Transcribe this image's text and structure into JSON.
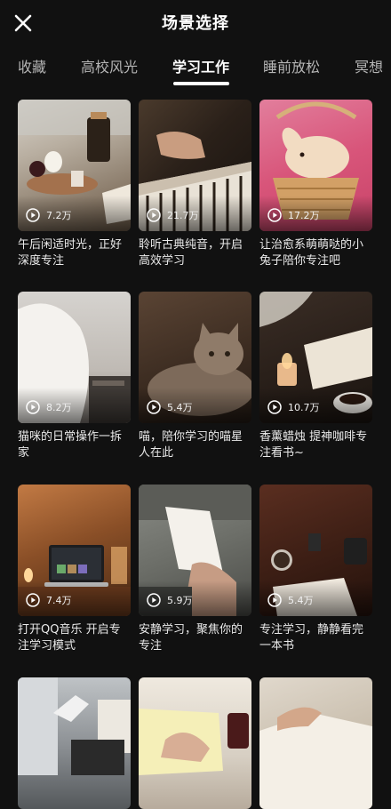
{
  "header": {
    "title": "场景选择"
  },
  "tabs": [
    {
      "label": "收藏"
    },
    {
      "label": "高校风光"
    },
    {
      "label": "学习工作"
    },
    {
      "label": "睡前放松"
    },
    {
      "label": "冥想"
    }
  ],
  "active_tab": 2,
  "cards": [
    {
      "plays": "7.2万",
      "caption": "午后闲适时光，正好深度专注"
    },
    {
      "plays": "21.7万",
      "caption": "聆听古典纯音，开启高效学习"
    },
    {
      "plays": "17.2万",
      "caption": "让治愈系萌萌哒的小兔子陪你专注吧"
    },
    {
      "plays": "8.2万",
      "caption": "猫咪的日常操作一拆家"
    },
    {
      "plays": "5.4万",
      "caption": "喵，陪你学习的喵星人在此"
    },
    {
      "plays": "10.7万",
      "caption": "香薰蜡烛 提神咖啡专注看书~"
    },
    {
      "plays": "7.4万",
      "caption": "打开QQ音乐 开启专注学习模式"
    },
    {
      "plays": "5.9万",
      "caption": "安静学习，聚焦你的专注"
    },
    {
      "plays": "5.4万",
      "caption": "专注学习，静静看完一本书"
    },
    {
      "plays": "",
      "caption": ""
    },
    {
      "plays": "",
      "caption": ""
    },
    {
      "plays": "",
      "caption": ""
    }
  ]
}
